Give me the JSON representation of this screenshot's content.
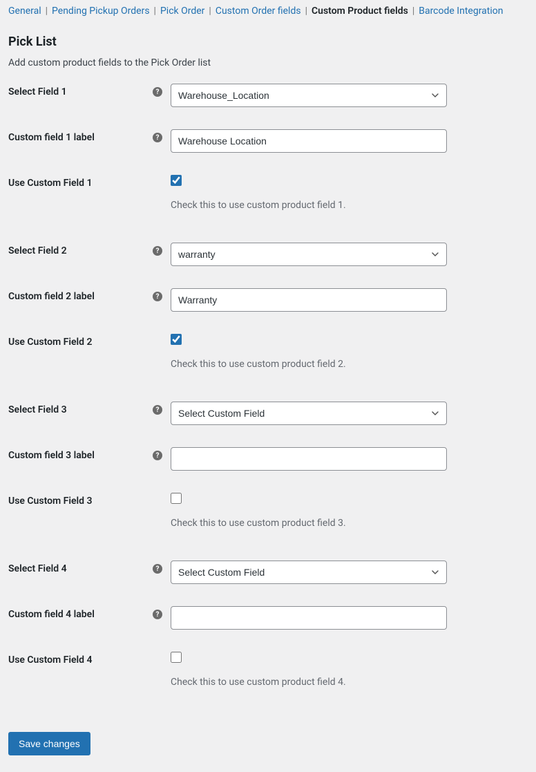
{
  "nav": {
    "items": [
      {
        "label": "General",
        "active": false
      },
      {
        "label": "Pending Pickup Orders",
        "active": false
      },
      {
        "label": "Pick Order",
        "active": false
      },
      {
        "label": "Custom Order fields",
        "active": false
      },
      {
        "label": "Custom Product fields",
        "active": true
      },
      {
        "label": "Barcode Integration",
        "active": false
      }
    ]
  },
  "page": {
    "heading": "Pick List",
    "subhead": "Add custom product fields to the Pick Order list"
  },
  "fields": [
    {
      "select_label": "Select Field 1",
      "select_value": "Warehouse_Location",
      "input_label": "Custom field 1 label",
      "input_value": "Warehouse Location",
      "use_label": "Use Custom Field 1",
      "use_checked": true,
      "use_help": "Check this to use custom product field 1."
    },
    {
      "select_label": "Select Field 2",
      "select_value": "warranty",
      "input_label": "Custom field 2 label",
      "input_value": "Warranty",
      "use_label": "Use Custom Field 2",
      "use_checked": true,
      "use_help": "Check this to use custom product field 2."
    },
    {
      "select_label": "Select Field 3",
      "select_value": "Select Custom Field",
      "input_label": "Custom field 3 label",
      "input_value": "",
      "use_label": "Use Custom Field 3",
      "use_checked": false,
      "use_help": "Check this to use custom product field 3."
    },
    {
      "select_label": "Select Field 4",
      "select_value": "Select Custom Field",
      "input_label": "Custom field 4 label",
      "input_value": "",
      "use_label": "Use Custom Field 4",
      "use_checked": false,
      "use_help": "Check this to use custom product field 4."
    }
  ],
  "buttons": {
    "save": "Save changes"
  }
}
